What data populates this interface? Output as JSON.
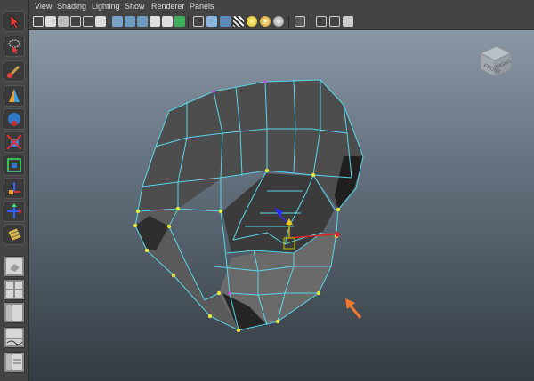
{
  "menu": {
    "items": [
      "View",
      "Shading",
      "Lighting",
      "Show",
      "Renderer",
      "Panels"
    ]
  },
  "view_cube": {
    "front_label": "FRONT",
    "side_label": "RIGHT"
  },
  "colors": {
    "wireframe": "#58d6e6",
    "vertex": "#e6e63c",
    "arrow": "#f07a2a",
    "mesh_face": "#5d5d5d"
  },
  "toolbox": {
    "tools": [
      "select-icon",
      "lasso-icon",
      "paint-select-icon",
      "move-icon",
      "rotate-icon",
      "scale-icon",
      "soft-mod-icon",
      "show-manipulator-icon",
      "last-tool-icon",
      "uv-tool-icon"
    ],
    "layouts": [
      "single-pane-layout",
      "four-pane-layout",
      "outliner-layout",
      "graph-layout",
      "time-layout"
    ]
  }
}
